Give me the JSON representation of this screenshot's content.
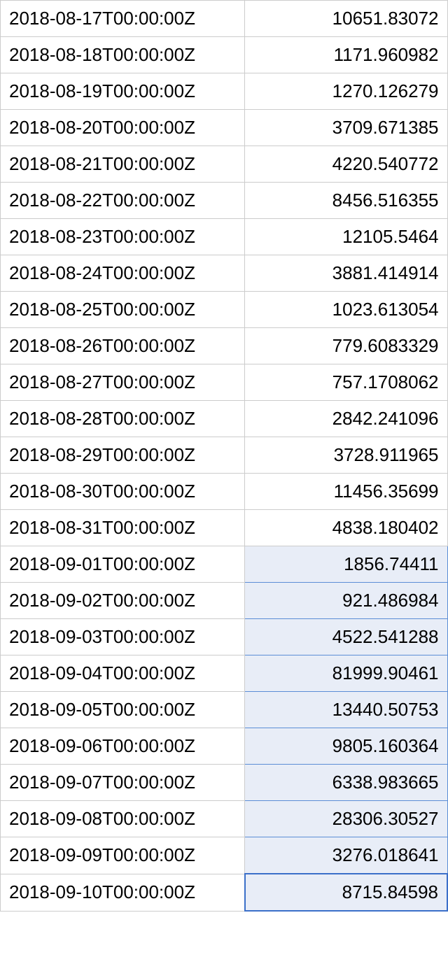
{
  "rows": [
    {
      "date": "2018-08-17T00:00:00Z",
      "value": "10651.83072",
      "state": "normal"
    },
    {
      "date": "2018-08-18T00:00:00Z",
      "value": "1171.960982",
      "state": "normal"
    },
    {
      "date": "2018-08-19T00:00:00Z",
      "value": "1270.126279",
      "state": "normal"
    },
    {
      "date": "2018-08-20T00:00:00Z",
      "value": "3709.671385",
      "state": "normal"
    },
    {
      "date": "2018-08-21T00:00:00Z",
      "value": "4220.540772",
      "state": "normal"
    },
    {
      "date": "2018-08-22T00:00:00Z",
      "value": "8456.516355",
      "state": "normal"
    },
    {
      "date": "2018-08-23T00:00:00Z",
      "value": "12105.5464",
      "state": "normal"
    },
    {
      "date": "2018-08-24T00:00:00Z",
      "value": "3881.414914",
      "state": "normal"
    },
    {
      "date": "2018-08-25T00:00:00Z",
      "value": "1023.613054",
      "state": "normal"
    },
    {
      "date": "2018-08-26T00:00:00Z",
      "value": "779.6083329",
      "state": "normal"
    },
    {
      "date": "2018-08-27T00:00:00Z",
      "value": "757.1708062",
      "state": "normal"
    },
    {
      "date": "2018-08-28T00:00:00Z",
      "value": "2842.241096",
      "state": "normal"
    },
    {
      "date": "2018-08-29T00:00:00Z",
      "value": "3728.911965",
      "state": "normal"
    },
    {
      "date": "2018-08-30T00:00:00Z",
      "value": "11456.35699",
      "state": "normal"
    },
    {
      "date": "2018-08-31T00:00:00Z",
      "value": "4838.180402",
      "state": "normal"
    },
    {
      "date": "2018-09-01T00:00:00Z",
      "value": "1856.74411",
      "state": "selected"
    },
    {
      "date": "2018-09-02T00:00:00Z",
      "value": "921.486984",
      "state": "selected"
    },
    {
      "date": "2018-09-03T00:00:00Z",
      "value": "4522.541288",
      "state": "selected"
    },
    {
      "date": "2018-09-04T00:00:00Z",
      "value": "81999.90461",
      "state": "selected"
    },
    {
      "date": "2018-09-05T00:00:00Z",
      "value": "13440.50753",
      "state": "selected"
    },
    {
      "date": "2018-09-06T00:00:00Z",
      "value": "9805.160364",
      "state": "selected"
    },
    {
      "date": "2018-09-07T00:00:00Z",
      "value": "6338.983665",
      "state": "selected"
    },
    {
      "date": "2018-09-08T00:00:00Z",
      "value": "28306.30527",
      "state": "selected"
    },
    {
      "date": "2018-09-09T00:00:00Z",
      "value": "3276.018641",
      "state": "selected"
    },
    {
      "date": "2018-09-10T00:00:00Z",
      "value": "8715.84598",
      "state": "active"
    }
  ]
}
